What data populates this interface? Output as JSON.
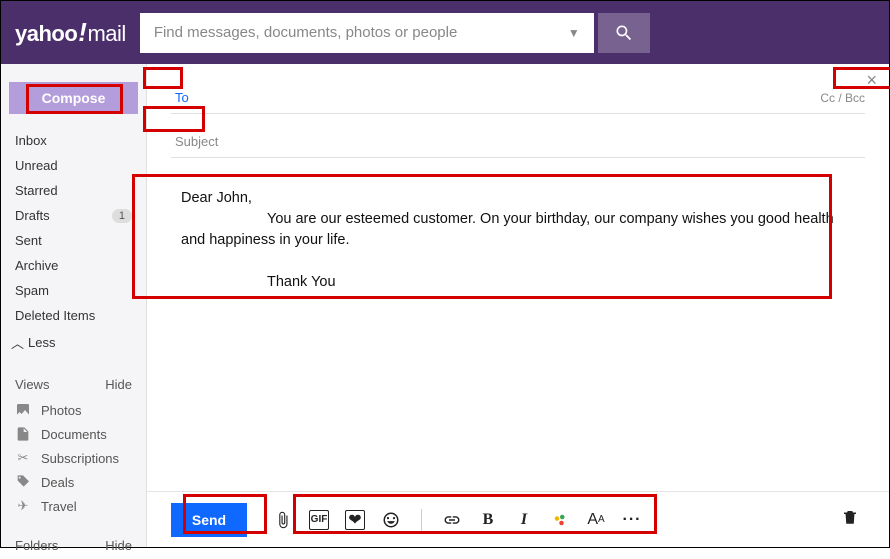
{
  "header": {
    "logo_main": "yahoo",
    "logo_bang": "!",
    "logo_sub": "mail",
    "search_placeholder": "Find messages, documents, photos or people"
  },
  "sidebar": {
    "compose_label": "Compose",
    "folders": {
      "inbox": "Inbox",
      "unread": "Unread",
      "starred": "Starred",
      "drafts": "Drafts",
      "drafts_badge": "1",
      "sent": "Sent",
      "archive": "Archive",
      "spam": "Spam",
      "deleted": "Deleted Items",
      "less": "Less"
    },
    "views_head": "Views",
    "hide_label": "Hide",
    "views": {
      "photos": "Photos",
      "documents": "Documents",
      "subscriptions": "Subscriptions",
      "deals": "Deals",
      "travel": "Travel"
    },
    "folders_head": "Folders"
  },
  "compose": {
    "to_label": "To",
    "ccbcc_label": "Cc / Bcc",
    "subject_placeholder": "Subject",
    "body_line1": "Dear John,",
    "body_line2": "You are our esteemed customer. On your birthday, our company wishes you good health and happiness in your life.",
    "body_line3": "Thank You"
  },
  "toolbar": {
    "send_label": "Send"
  }
}
